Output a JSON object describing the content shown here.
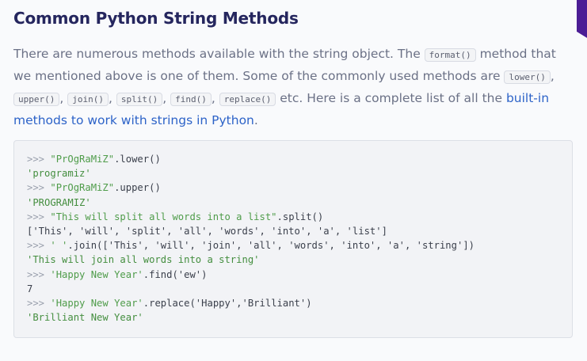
{
  "heading": "Common Python String Methods",
  "paragraph": {
    "t1": "There are numerous methods available with the string object. The ",
    "c_format": "format()",
    "t2": " method that we mentioned above is one of them. Some of the commonly used methods are ",
    "c_lower": "lower()",
    "sep": ",",
    "c_upper": "upper()",
    "c_join": "join()",
    "c_split": "split()",
    "c_find": "find()",
    "c_replace": "replace()",
    "t3": " etc. Here is a complete list of all the ",
    "link": "built-in methods to work with strings in Python",
    "t4": "."
  },
  "code": {
    "prompt": ">>>",
    "l1_str": "\"PrOgRaMiZ\"",
    "l1_call": ".lower()",
    "l2_out": "'programiz'",
    "l3_str": "\"PrOgRaMiZ\"",
    "l3_call": ".upper()",
    "l4_out": "'PROGRAMIZ'",
    "l5_str": "\"This will split all words into a list\"",
    "l5_call": ".split()",
    "l6_out": "['This', 'will', 'split', 'all', 'words', 'into', 'a', 'list']",
    "l7_str": "' '",
    "l7_call": ".join(['This', 'will', 'join', 'all', 'words', 'into', 'a', 'string'])",
    "l8_out": "'This will join all words into a string'",
    "l9_str": "'Happy New Year'",
    "l9_call": ".find('ew')",
    "l10_out": "7",
    "l11_str": "'Happy New Year'",
    "l11_call": ".replace('Happy','Brilliant')",
    "l12_out": "'Brilliant New Year'"
  },
  "colors": {
    "heading": "#25265e",
    "link": "#2d63c8",
    "string": "#4f9c4a",
    "accent_corner": "#5b21b6"
  }
}
